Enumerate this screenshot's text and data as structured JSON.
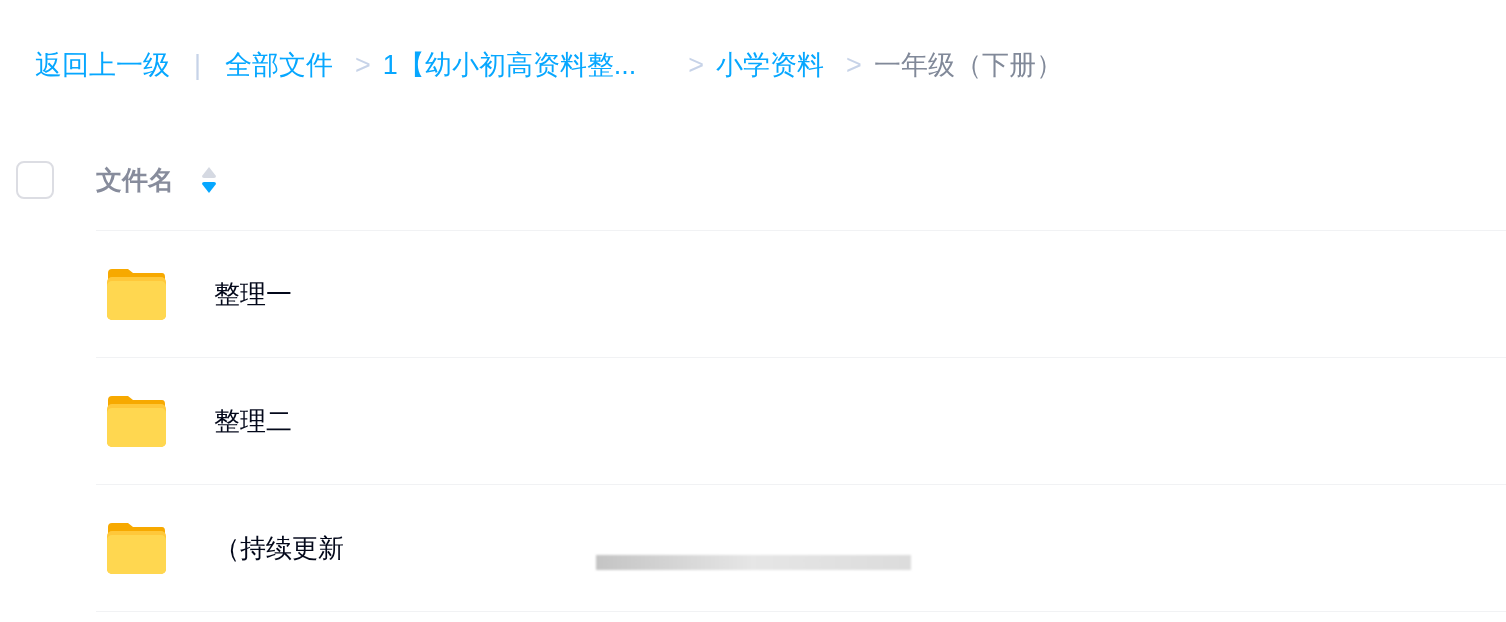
{
  "breadcrumb": [
    {
      "kind": "link",
      "text": "返回上一级"
    },
    {
      "kind": "divider",
      "text": "|"
    },
    {
      "kind": "link",
      "text": "全部文件"
    },
    {
      "kind": "separator",
      "text": ">"
    },
    {
      "kind": "link",
      "text": "1【幼小初高资料整..."
    },
    {
      "kind": "separator",
      "text": ">"
    },
    {
      "kind": "link",
      "text": "小学资料"
    },
    {
      "kind": "separator",
      "text": ">"
    },
    {
      "kind": "current",
      "text": "一年级（下册）"
    }
  ],
  "table": {
    "select_all": {
      "checked": false
    },
    "column": {
      "label": "文件名",
      "sorted_descending": true
    },
    "rows": [
      {
        "kind": "folder",
        "name": "整理一",
        "redacted": false
      },
      {
        "kind": "folder",
        "name": "整理二",
        "redacted": false
      },
      {
        "kind": "folder",
        "name": "（持续更新",
        "redacted": true
      }
    ]
  }
}
